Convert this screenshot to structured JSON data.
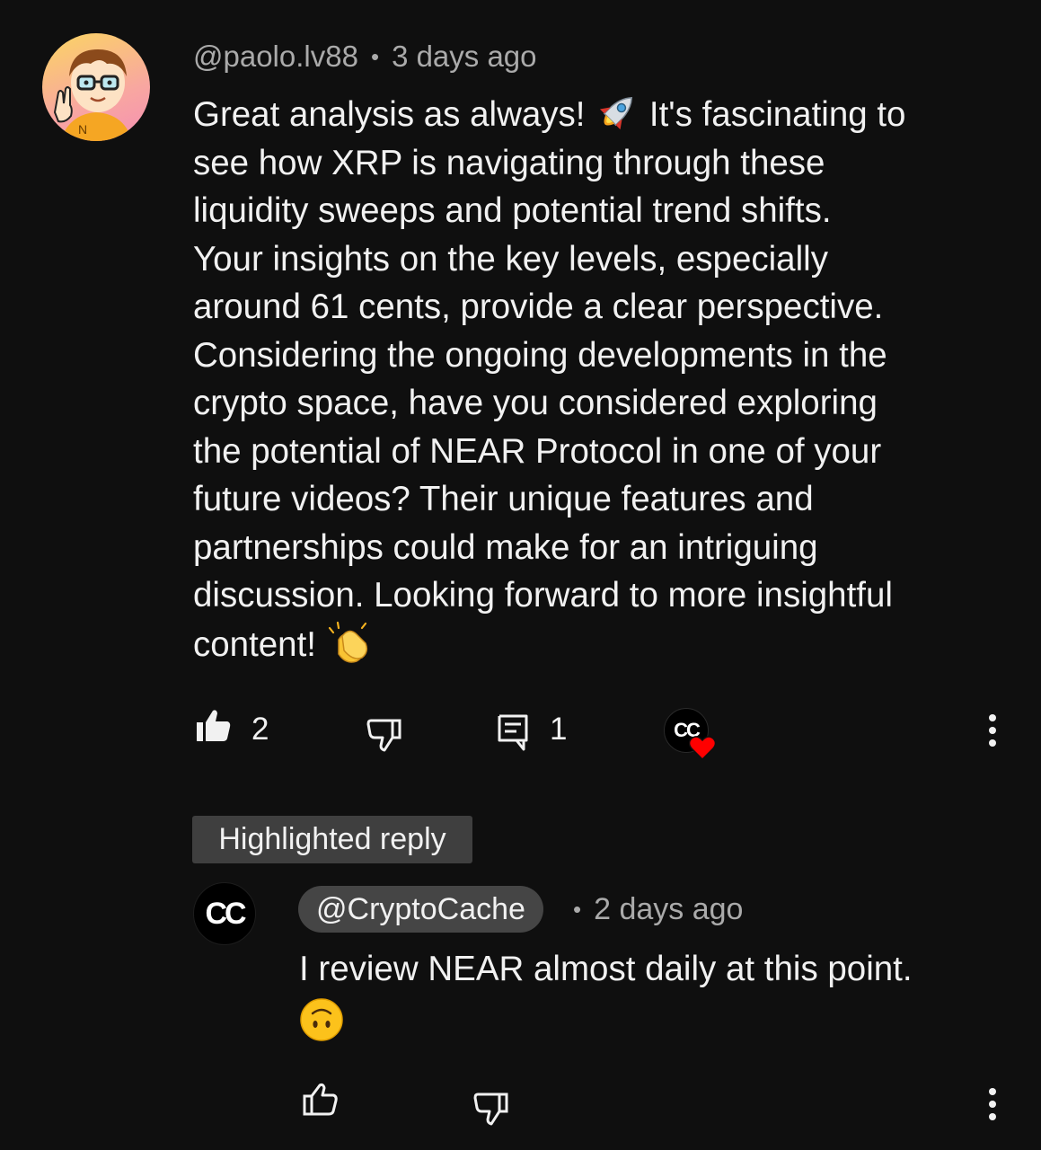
{
  "comment": {
    "author": "@paolo.lv88",
    "time": "3 days ago",
    "lines": [
      {
        "text": "Great analysis as always! ",
        "emoji": "rocket",
        "after": " It's fascinating to"
      },
      {
        "text": "see how XRP is navigating through these"
      },
      {
        "text": "liquidity sweeps and potential trend shifts."
      },
      {
        "text": "Your insights on the key levels, especially"
      },
      {
        "text": "around 61 cents, provide a clear perspective."
      },
      {
        "text": "Considering the ongoing developments in the"
      },
      {
        "text": "crypto space, have you considered exploring"
      },
      {
        "text": "the potential of NEAR Protocol in one of your"
      },
      {
        "text": "future videos? Their unique features and"
      },
      {
        "text": "partnerships could make for an intriguing"
      },
      {
        "text": "discussion. Looking forward to more insightful"
      },
      {
        "text": "content! ",
        "emoji": "clapping-hands"
      }
    ],
    "like_count": "2",
    "reply_count": "1",
    "creator_heart_badge": "CC"
  },
  "reply": {
    "highlight_label": "Highlighted reply",
    "avatar_text": "CC",
    "author": "@CryptoCache",
    "time": "2 days ago",
    "text": "I review NEAR almost daily at this point.",
    "emoji": "upside-down-face"
  },
  "colors": {
    "background": "#0f0f0f",
    "text": "#f1f1f1",
    "secondary_text": "#aaaaaa",
    "chip": "#3f3f3f",
    "heart": "#ff0000"
  }
}
